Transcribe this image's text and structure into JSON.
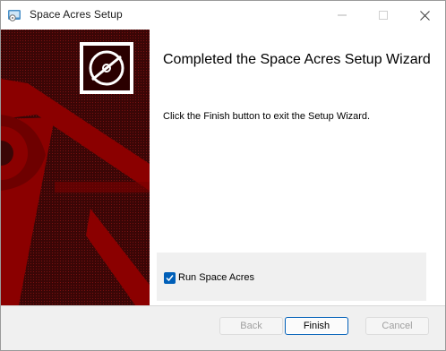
{
  "window": {
    "title": "Space Acres Setup"
  },
  "caption_buttons": {
    "minimize_icon": "minimize-icon",
    "maximize_icon": "maximize-icon",
    "close_icon": "close-icon"
  },
  "banner": {
    "logo_icon": "disc-logo-icon",
    "accent_color": "#7a0000"
  },
  "main": {
    "heading": "Completed the Space Acres Setup Wizard",
    "instruction": "Click the Finish button to exit the Setup Wizard."
  },
  "options": {
    "run_app_label": "Run Space Acres",
    "run_app_checked": true,
    "checkbox_color": "#005fb8"
  },
  "footer": {
    "back_label": "Back",
    "back_enabled": false,
    "finish_label": "Finish",
    "finish_enabled": true,
    "cancel_label": "Cancel",
    "cancel_enabled": false
  }
}
